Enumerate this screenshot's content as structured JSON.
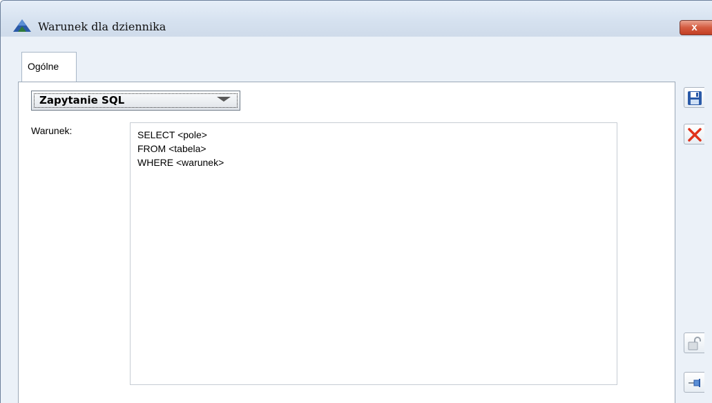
{
  "window": {
    "title": "Warunek dla dziennika",
    "close_label": "x"
  },
  "tabs": [
    {
      "label": "Ogólne",
      "selected": true
    }
  ],
  "query_type": {
    "selected": "Zapytanie SQL"
  },
  "condition": {
    "label": "Warunek:",
    "lines": [
      "SELECT <pole>",
      "FROM <tabela>",
      "WHERE <warunek>"
    ]
  },
  "toolbar": {
    "icons": [
      "save-icon",
      "cancel-icon",
      "unlock-icon",
      "pin-icon"
    ]
  },
  "colors": {
    "accent": "#2a5aa8",
    "cancel_red": "#e0331c",
    "close_red": "#c23f24"
  }
}
